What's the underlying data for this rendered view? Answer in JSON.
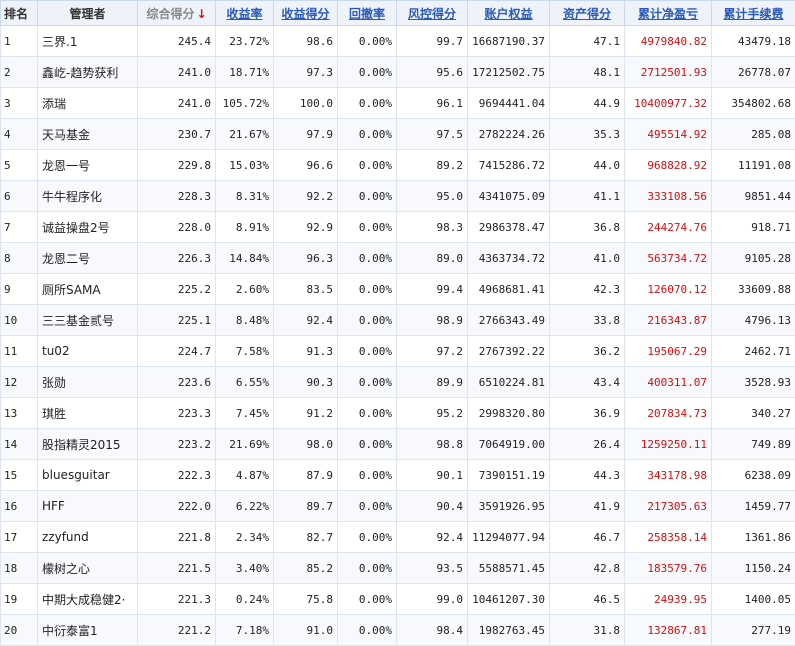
{
  "headers": {
    "rank": "排名",
    "manager": "管理者",
    "composite_score": "综合得分",
    "return_rate": "收益率",
    "return_score": "收益得分",
    "drawdown_rate": "回撤率",
    "risk_score": "风控得分",
    "account_equity": "账户权益",
    "asset_score": "资产得分",
    "cum_net_profit": "累计净盈亏",
    "cum_fees": "累计手续费"
  },
  "sort": {
    "column": "composite_score",
    "direction": "desc",
    "indicator": "↓"
  },
  "colors": {
    "profit": "#d01010",
    "header_link": "#2a5ab8",
    "header_bg": "#eef3fa"
  },
  "rows": [
    {
      "rank": "1",
      "manager": "三界.1",
      "composite_score": "245.4",
      "return_rate": "23.72%",
      "return_score": "98.6",
      "drawdown_rate": "0.00%",
      "risk_score": "99.7",
      "account_equity": "16687190.37",
      "asset_score": "47.1",
      "cum_net_profit": "4979840.82",
      "cum_fees": "43479.18"
    },
    {
      "rank": "2",
      "manager": "鑫屹-趋势获利",
      "composite_score": "241.0",
      "return_rate": "18.71%",
      "return_score": "97.3",
      "drawdown_rate": "0.00%",
      "risk_score": "95.6",
      "account_equity": "17212502.75",
      "asset_score": "48.1",
      "cum_net_profit": "2712501.93",
      "cum_fees": "26778.07"
    },
    {
      "rank": "3",
      "manager": "添瑞",
      "composite_score": "241.0",
      "return_rate": "105.72%",
      "return_score": "100.0",
      "drawdown_rate": "0.00%",
      "risk_score": "96.1",
      "account_equity": "9694441.04",
      "asset_score": "44.9",
      "cum_net_profit": "10400977.32",
      "cum_fees": "354802.68"
    },
    {
      "rank": "4",
      "manager": "天马基金",
      "composite_score": "230.7",
      "return_rate": "21.67%",
      "return_score": "97.9",
      "drawdown_rate": "0.00%",
      "risk_score": "97.5",
      "account_equity": "2782224.26",
      "asset_score": "35.3",
      "cum_net_profit": "495514.92",
      "cum_fees": "285.08"
    },
    {
      "rank": "5",
      "manager": "龙恩一号",
      "composite_score": "229.8",
      "return_rate": "15.03%",
      "return_score": "96.6",
      "drawdown_rate": "0.00%",
      "risk_score": "89.2",
      "account_equity": "7415286.72",
      "asset_score": "44.0",
      "cum_net_profit": "968828.92",
      "cum_fees": "11191.08"
    },
    {
      "rank": "6",
      "manager": "牛牛程序化",
      "composite_score": "228.3",
      "return_rate": "8.31%",
      "return_score": "92.2",
      "drawdown_rate": "0.00%",
      "risk_score": "95.0",
      "account_equity": "4341075.09",
      "asset_score": "41.1",
      "cum_net_profit": "333108.56",
      "cum_fees": "9851.44"
    },
    {
      "rank": "7",
      "manager": "诚益操盘2号",
      "composite_score": "228.0",
      "return_rate": "8.91%",
      "return_score": "92.9",
      "drawdown_rate": "0.00%",
      "risk_score": "98.3",
      "account_equity": "2986378.47",
      "asset_score": "36.8",
      "cum_net_profit": "244274.76",
      "cum_fees": "918.71"
    },
    {
      "rank": "8",
      "manager": "龙恩二号",
      "composite_score": "226.3",
      "return_rate": "14.84%",
      "return_score": "96.3",
      "drawdown_rate": "0.00%",
      "risk_score": "89.0",
      "account_equity": "4363734.72",
      "asset_score": "41.0",
      "cum_net_profit": "563734.72",
      "cum_fees": "9105.28"
    },
    {
      "rank": "9",
      "manager": "厕所SAMA",
      "composite_score": "225.2",
      "return_rate": "2.60%",
      "return_score": "83.5",
      "drawdown_rate": "0.00%",
      "risk_score": "99.4",
      "account_equity": "4968681.41",
      "asset_score": "42.3",
      "cum_net_profit": "126070.12",
      "cum_fees": "33609.88"
    },
    {
      "rank": "10",
      "manager": "三三基金贰号",
      "composite_score": "225.1",
      "return_rate": "8.48%",
      "return_score": "92.4",
      "drawdown_rate": "0.00%",
      "risk_score": "98.9",
      "account_equity": "2766343.49",
      "asset_score": "33.8",
      "cum_net_profit": "216343.87",
      "cum_fees": "4796.13"
    },
    {
      "rank": "11",
      "manager": "tu02",
      "composite_score": "224.7",
      "return_rate": "7.58%",
      "return_score": "91.3",
      "drawdown_rate": "0.00%",
      "risk_score": "97.2",
      "account_equity": "2767392.22",
      "asset_score": "36.2",
      "cum_net_profit": "195067.29",
      "cum_fees": "2462.71"
    },
    {
      "rank": "12",
      "manager": "张勋",
      "composite_score": "223.6",
      "return_rate": "6.55%",
      "return_score": "90.3",
      "drawdown_rate": "0.00%",
      "risk_score": "89.9",
      "account_equity": "6510224.81",
      "asset_score": "43.4",
      "cum_net_profit": "400311.07",
      "cum_fees": "3528.93"
    },
    {
      "rank": "13",
      "manager": "琪胜",
      "composite_score": "223.3",
      "return_rate": "7.45%",
      "return_score": "91.2",
      "drawdown_rate": "0.00%",
      "risk_score": "95.2",
      "account_equity": "2998320.80",
      "asset_score": "36.9",
      "cum_net_profit": "207834.73",
      "cum_fees": "340.27"
    },
    {
      "rank": "14",
      "manager": "股指精灵2015",
      "composite_score": "223.2",
      "return_rate": "21.69%",
      "return_score": "98.0",
      "drawdown_rate": "0.00%",
      "risk_score": "98.8",
      "account_equity": "7064919.00",
      "asset_score": "26.4",
      "cum_net_profit": "1259250.11",
      "cum_fees": "749.89"
    },
    {
      "rank": "15",
      "manager": "bluesguitar",
      "composite_score": "222.3",
      "return_rate": "4.87%",
      "return_score": "87.9",
      "drawdown_rate": "0.00%",
      "risk_score": "90.1",
      "account_equity": "7390151.19",
      "asset_score": "44.3",
      "cum_net_profit": "343178.98",
      "cum_fees": "6238.09"
    },
    {
      "rank": "16",
      "manager": "HFF",
      "composite_score": "222.0",
      "return_rate": "6.22%",
      "return_score": "89.7",
      "drawdown_rate": "0.00%",
      "risk_score": "90.4",
      "account_equity": "3591926.95",
      "asset_score": "41.9",
      "cum_net_profit": "217305.63",
      "cum_fees": "1459.77"
    },
    {
      "rank": "17",
      "manager": "zzyfund",
      "composite_score": "221.8",
      "return_rate": "2.34%",
      "return_score": "82.7",
      "drawdown_rate": "0.00%",
      "risk_score": "92.4",
      "account_equity": "11294077.94",
      "asset_score": "46.7",
      "cum_net_profit": "258358.14",
      "cum_fees": "1361.86"
    },
    {
      "rank": "18",
      "manager": "檬树之心",
      "composite_score": "221.5",
      "return_rate": "3.40%",
      "return_score": "85.2",
      "drawdown_rate": "0.00%",
      "risk_score": "93.5",
      "account_equity": "5588571.45",
      "asset_score": "42.8",
      "cum_net_profit": "183579.76",
      "cum_fees": "1150.24"
    },
    {
      "rank": "19",
      "manager": "中期大成稳健2·",
      "composite_score": "221.3",
      "return_rate": "0.24%",
      "return_score": "75.8",
      "drawdown_rate": "0.00%",
      "risk_score": "99.0",
      "account_equity": "10461207.30",
      "asset_score": "46.5",
      "cum_net_profit": "24939.95",
      "cum_fees": "1400.05"
    },
    {
      "rank": "20",
      "manager": "中衍泰富1",
      "composite_score": "221.2",
      "return_rate": "7.18%",
      "return_score": "91.0",
      "drawdown_rate": "0.00%",
      "risk_score": "98.4",
      "account_equity": "1982763.45",
      "asset_score": "31.8",
      "cum_net_profit": "132867.81",
      "cum_fees": "277.19"
    }
  ]
}
